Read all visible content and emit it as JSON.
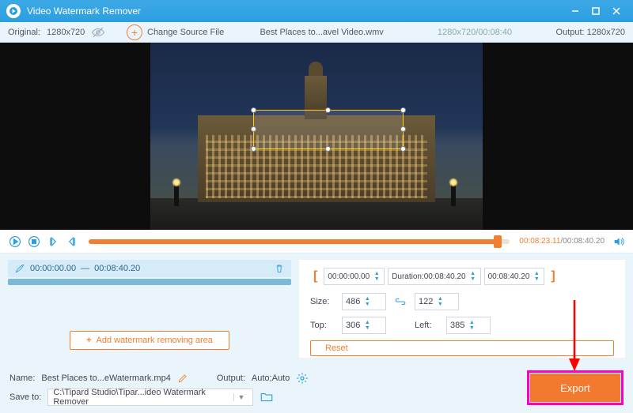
{
  "titlebar": {
    "title": "Video Watermark Remover"
  },
  "infobar": {
    "original_label": "Original:",
    "original_res": "1280x720",
    "change_source": "Change Source File",
    "source_filename": "Best Places to...avel Video.wmv",
    "source_dims_time": "1280x720/00:08:40",
    "output_label": "Output:",
    "output_res": "1280x720"
  },
  "playback": {
    "current_time": "00:08:23.11",
    "total_time": "00:08:40.20"
  },
  "clip": {
    "start": "00:00:00.00",
    "sep": "—",
    "end": "00:08:40.20"
  },
  "trim": {
    "start": "00:00:00.00",
    "duration_label": "Duration:",
    "duration": "00:08:40.20",
    "end": "00:08:40.20"
  },
  "dims": {
    "size_label": "Size:",
    "size_w": "486",
    "size_h": "122",
    "top_label": "Top:",
    "top_v": "306",
    "left_label": "Left:",
    "left_v": "385"
  },
  "buttons": {
    "add_area": "Add watermark removing area",
    "reset": "Reset",
    "export": "Export"
  },
  "bottom": {
    "name_label": "Name:",
    "name_value": "Best Places to...eWatermark.mp4",
    "output_label": "Output:",
    "output_value": "Auto;Auto",
    "save_label": "Save to:",
    "save_path": "C:\\Tipard Studio\\Tipar...ideo Watermark Remover"
  }
}
